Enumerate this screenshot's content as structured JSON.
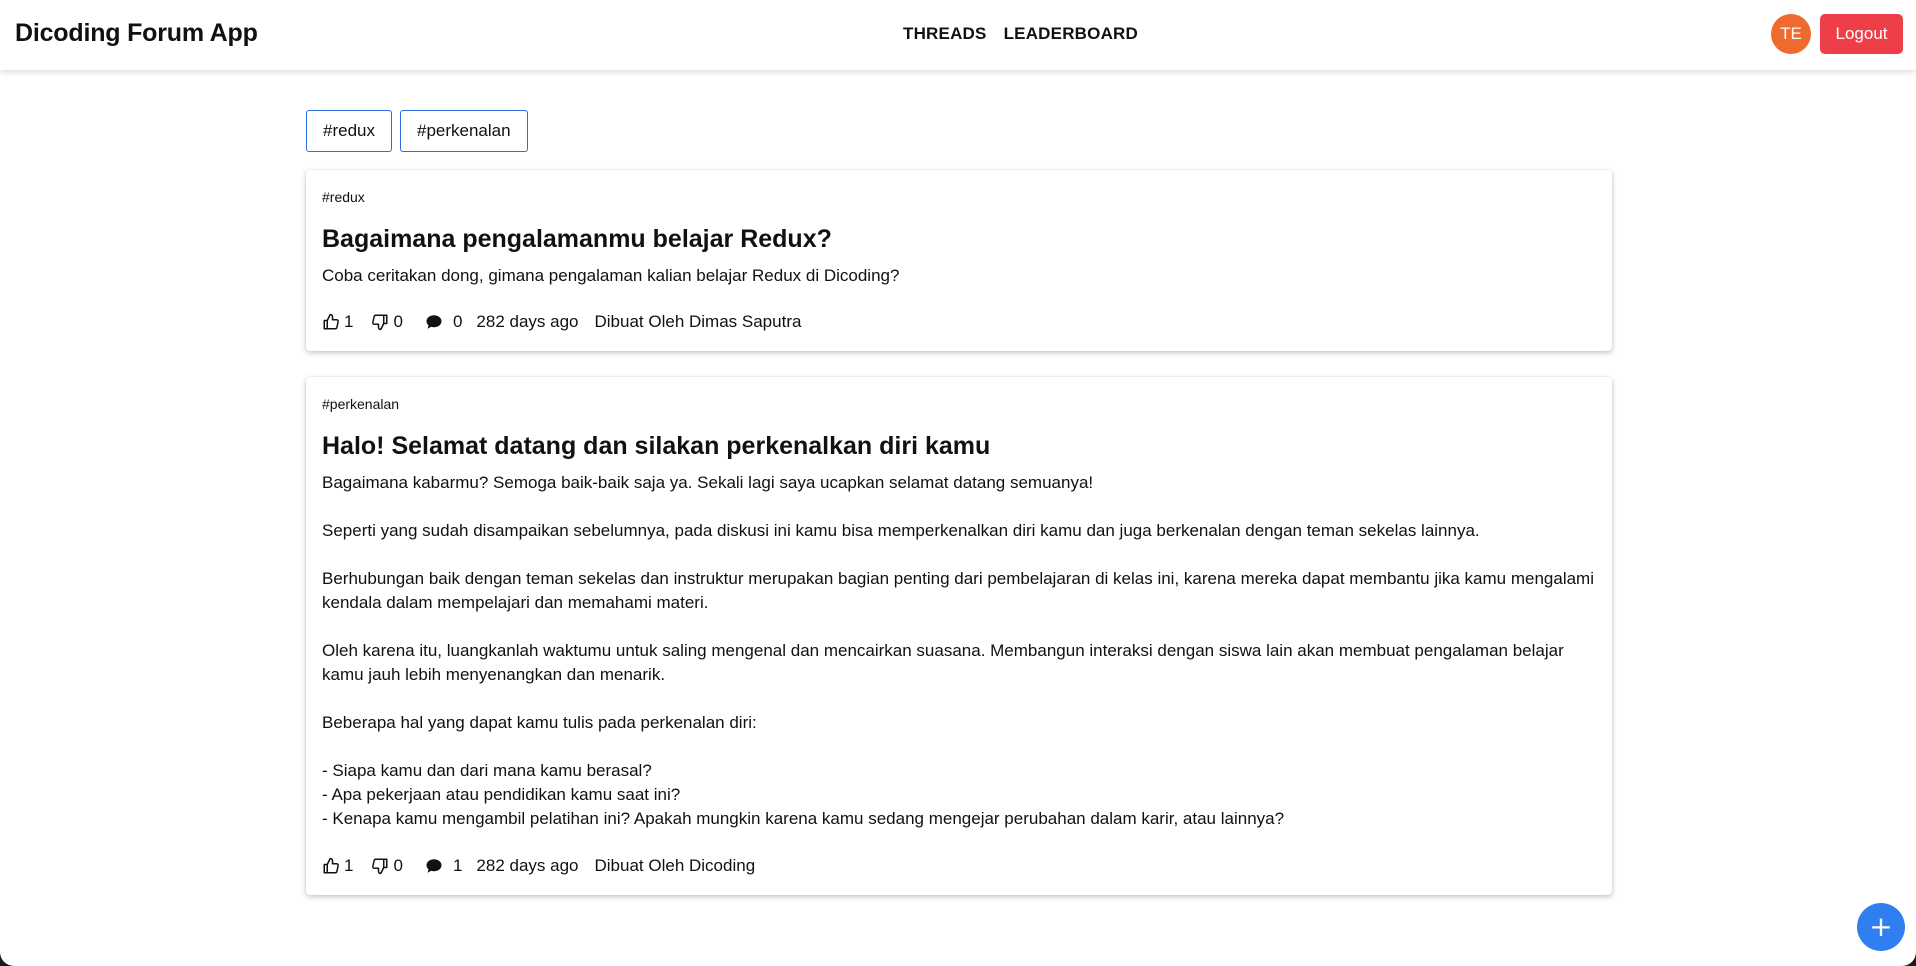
{
  "header": {
    "title": "Dicoding Forum App",
    "nav": [
      "THREADS",
      "LEADERBOARD"
    ],
    "avatar_initials": "TE",
    "logout_label": "Logout"
  },
  "tag_filters": [
    "#redux",
    "#perkenalan"
  ],
  "threads": [
    {
      "category": "#redux",
      "title": "Bagaimana pengalamanmu belajar Redux?",
      "body": [
        "Coba ceritakan dong, gimana pengalaman kalian belajar Redux di Dicoding?"
      ],
      "upvotes": "1",
      "downvotes": "0",
      "comments": "0",
      "time": "282 days ago",
      "author": "Dibuat Oleh Dimas Saputra"
    },
    {
      "category": "#perkenalan",
      "title": "Halo! Selamat datang dan silakan perkenalkan diri kamu",
      "body": [
        "Bagaimana kabarmu? Semoga baik-baik saja ya. Sekali lagi saya ucapkan selamat datang semuanya!",
        "Seperti yang sudah disampaikan sebelumnya, pada diskusi ini kamu bisa memperkenalkan diri kamu dan juga berkenalan dengan teman sekelas lainnya.",
        "Berhubungan baik dengan teman sekelas dan instruktur merupakan bagian penting dari pembelajaran di kelas ini, karena mereka dapat membantu jika kamu mengalami kendala dalam mempelajari dan memahami materi.",
        "Oleh karena itu, luangkanlah waktumu untuk saling mengenal dan mencairkan suasana. Membangun interaksi dengan siswa lain akan membuat pengalaman belajar kamu jauh lebih menyenangkan dan menarik.",
        "Beberapa hal yang dapat kamu tulis pada perkenalan diri:",
        "- Siapa kamu dan dari mana kamu berasal?",
        "- Apa pekerjaan atau pendidikan kamu saat ini?",
        "- Kenapa kamu mengambil pelatihan ini? Apakah mungkin karena kamu sedang mengejar perubahan dalam karir, atau lainnya?"
      ],
      "upvotes": "1",
      "downvotes": "0",
      "comments": "1",
      "time": "282 days ago",
      "author": "Dibuat Oleh Dicoding"
    }
  ],
  "fab_label": "+",
  "colors": {
    "logout": "#ee3e48",
    "avatar": "#ef6a2e",
    "fab": "#2f7ff0",
    "tag_border": "#2b6fe0"
  }
}
